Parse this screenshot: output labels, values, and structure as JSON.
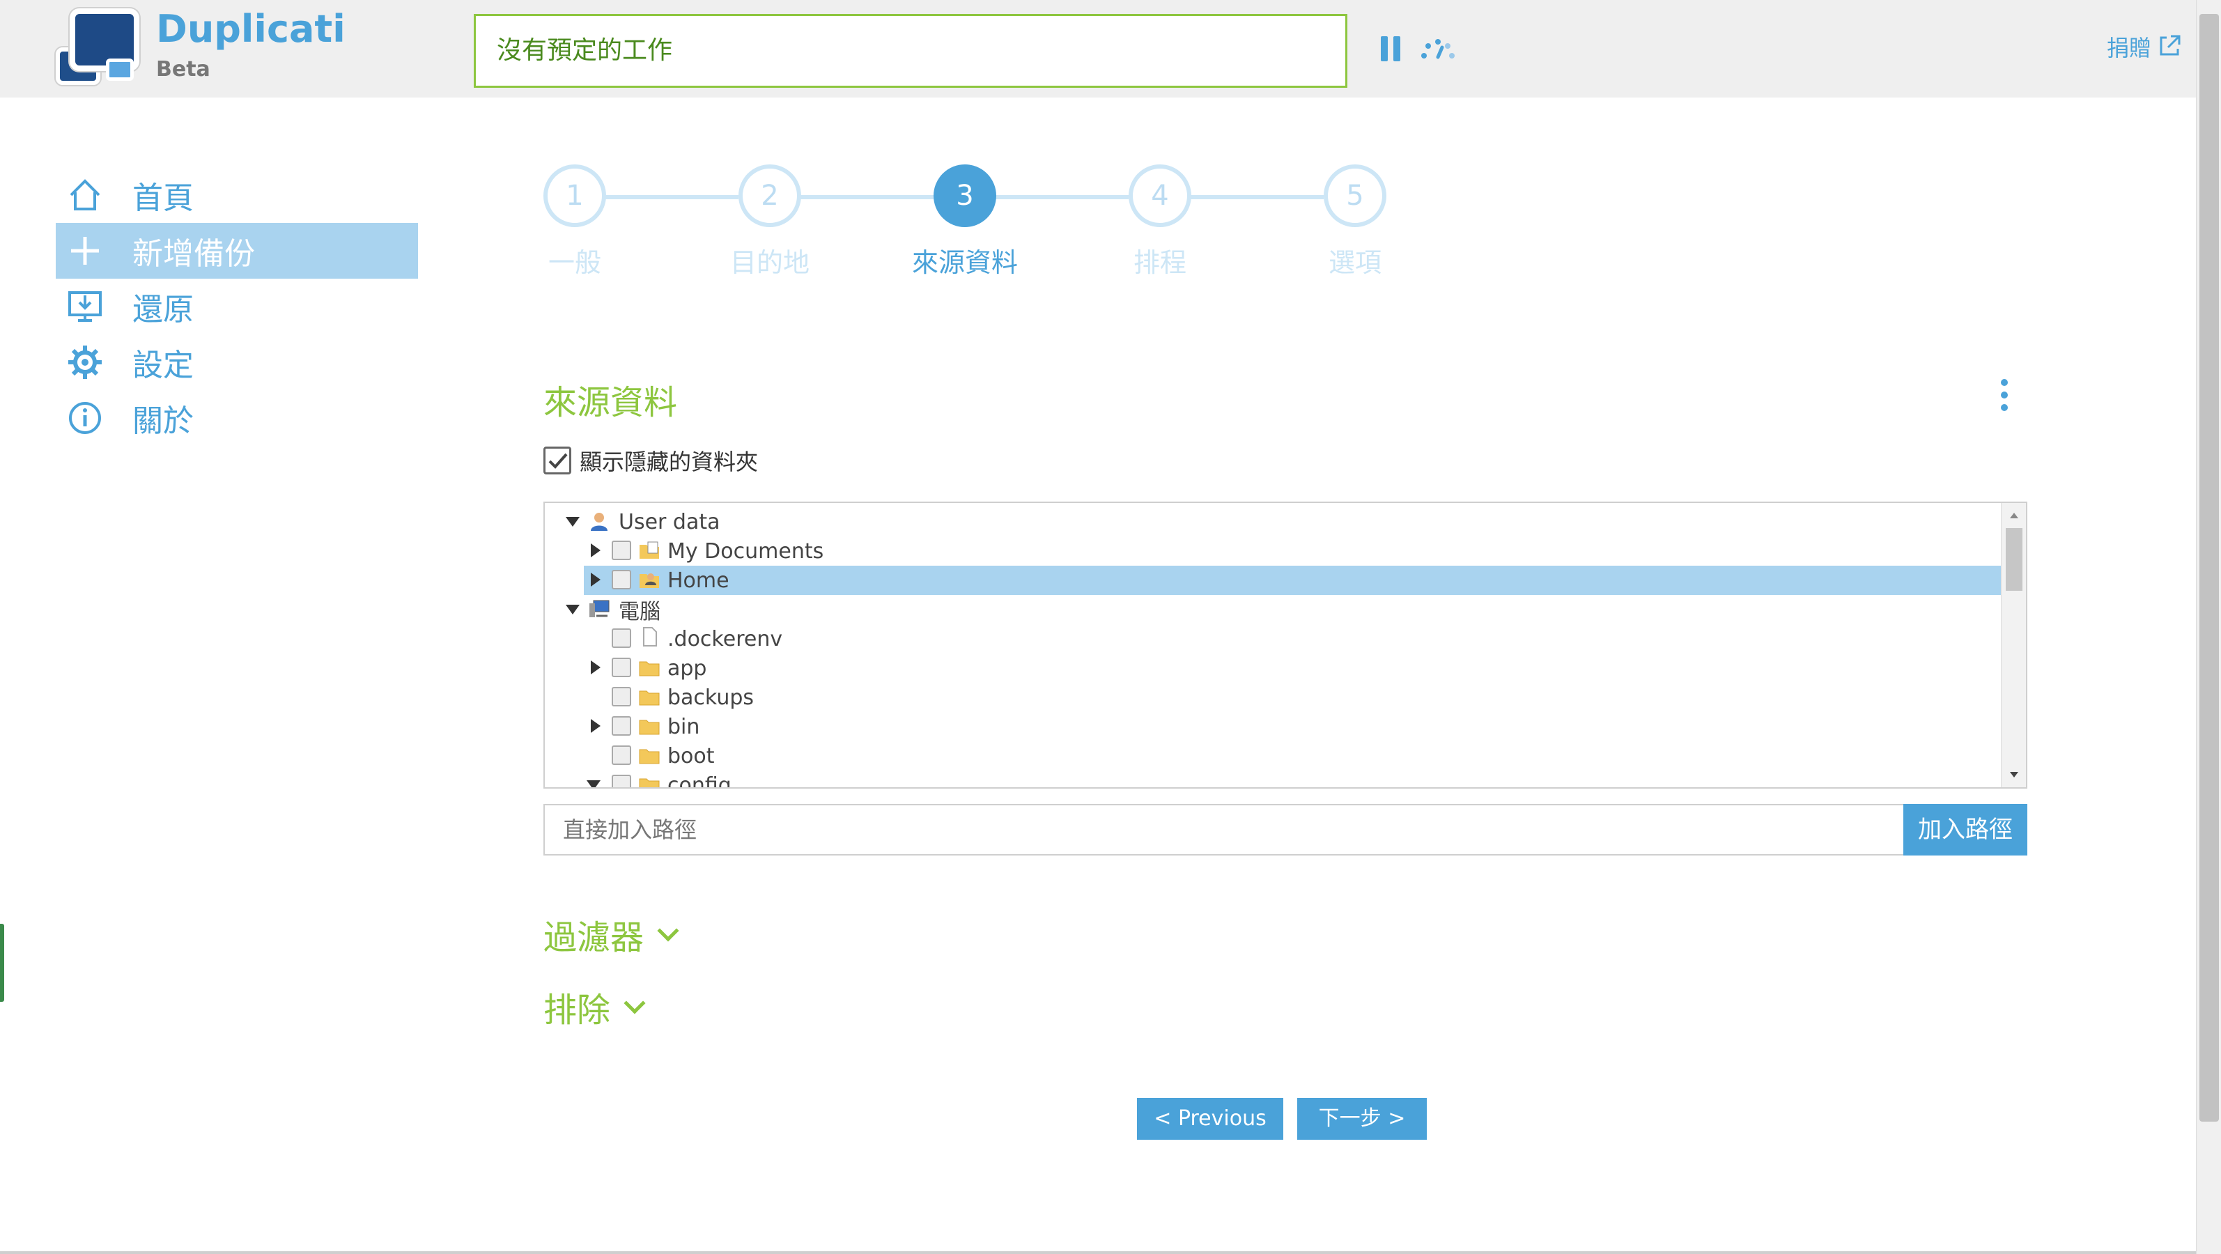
{
  "header": {
    "app_name": "Duplicati",
    "app_subtitle": "Beta",
    "status": "沒有預定的工作",
    "donate": "捐贈"
  },
  "sidebar": {
    "items": [
      {
        "label": "首頁",
        "icon": "home-icon"
      },
      {
        "label": "新增備份",
        "icon": "plus-icon",
        "active": true
      },
      {
        "label": "還原",
        "icon": "restore-icon"
      },
      {
        "label": "設定",
        "icon": "gear-icon"
      },
      {
        "label": "關於",
        "icon": "info-icon"
      }
    ]
  },
  "steps": [
    {
      "number": "1",
      "label": "一般"
    },
    {
      "number": "2",
      "label": "目的地"
    },
    {
      "number": "3",
      "label": "來源資料",
      "active": true
    },
    {
      "number": "4",
      "label": "排程"
    },
    {
      "number": "5",
      "label": "選項"
    }
  ],
  "main": {
    "title": "來源資料",
    "show_hidden_label": "顯示隱藏的資料夾",
    "show_hidden_checked": true,
    "path_placeholder": "直接加入路徑",
    "add_path_button": "加入路徑",
    "filters_label": "過濾器",
    "exclude_label": "排除"
  },
  "tree": [
    {
      "label": "User data",
      "expand": "down",
      "check": false,
      "icon": "user-icon"
    },
    {
      "label": "My Documents",
      "expand": "right",
      "check": true,
      "icon": "folder-doc-icon"
    },
    {
      "label": "Home",
      "expand": "right",
      "check": true,
      "icon": "home-folder-icon",
      "selected": true
    },
    {
      "label": "電腦",
      "expand": "down",
      "check": false,
      "icon": "computer-icon"
    },
    {
      "label": ".dockerenv",
      "expand": "",
      "check": true,
      "icon": "file-icon"
    },
    {
      "label": "app",
      "expand": "right",
      "check": true,
      "icon": "folder-icon"
    },
    {
      "label": "backups",
      "expand": "",
      "check": true,
      "icon": "folder-icon"
    },
    {
      "label": "bin",
      "expand": "right",
      "check": true,
      "icon": "folder-icon"
    },
    {
      "label": "boot",
      "expand": "",
      "check": true,
      "icon": "folder-icon"
    },
    {
      "label": "config",
      "expand": "down",
      "check": true,
      "icon": "folder-icon"
    }
  ],
  "nav": {
    "previous": "< Previous",
    "next": "下一步 >"
  },
  "colors": {
    "accent": "#4aa2d9",
    "green": "#8dc63f",
    "active_sidebar": "#a9d3ef"
  }
}
